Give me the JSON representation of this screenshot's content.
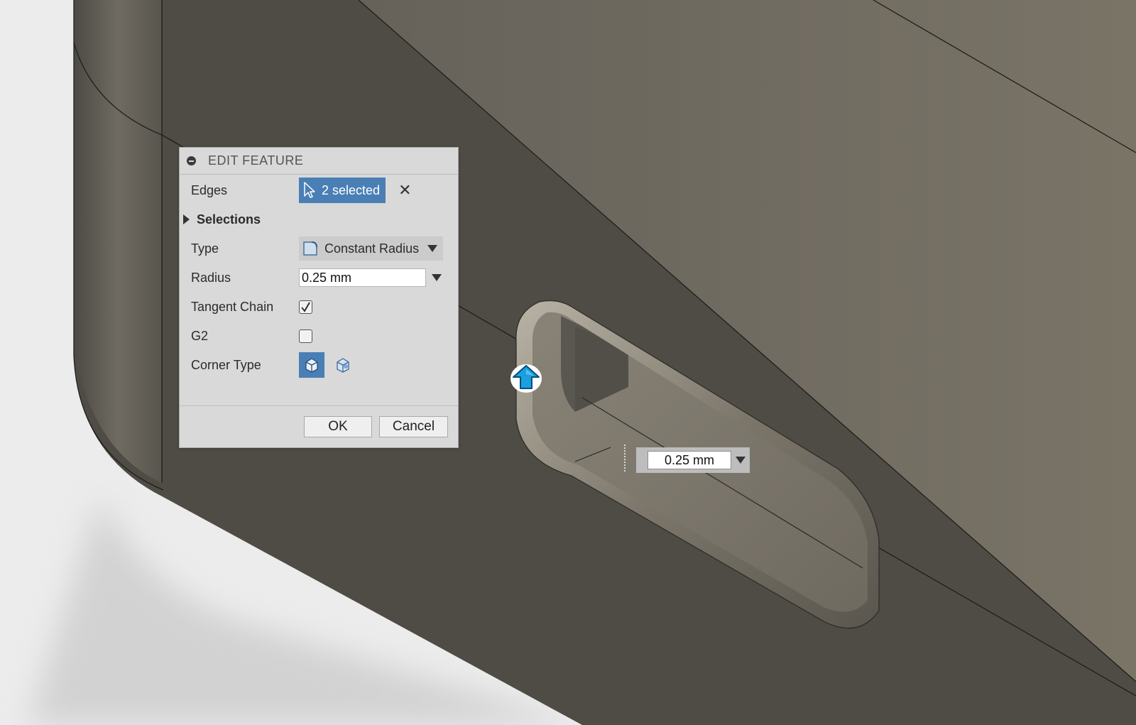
{
  "dialog": {
    "title": "EDIT FEATURE",
    "collapse_icon": "collapse-circle-icon",
    "edges": {
      "label": "Edges",
      "value": "2 selected",
      "icon": "cursor-arrow-icon",
      "clear_icon": "close-x-icon",
      "clear_glyph": "✕"
    },
    "selections": {
      "label": "Selections",
      "icon": "expand-triangle-icon"
    },
    "type": {
      "label": "Type",
      "value": "Constant Radius",
      "icon": "constant-radius-icon"
    },
    "radius": {
      "label": "Radius",
      "value": "0.25 mm"
    },
    "tangent_chain": {
      "label": "Tangent Chain",
      "checked": true
    },
    "g2": {
      "label": "G2",
      "checked": false
    },
    "corner_type": {
      "label": "Corner Type",
      "options": [
        "rolling-ball-corner-icon",
        "setback-corner-icon"
      ],
      "selected": 0
    },
    "ok_label": "OK",
    "cancel_label": "Cancel"
  },
  "canvas": {
    "dimension_value": "0.25 mm",
    "manipulator_icon": "blue-drag-arrow-icon",
    "accent": "#1a9fe0",
    "selection_color": "#4a7fb5"
  }
}
